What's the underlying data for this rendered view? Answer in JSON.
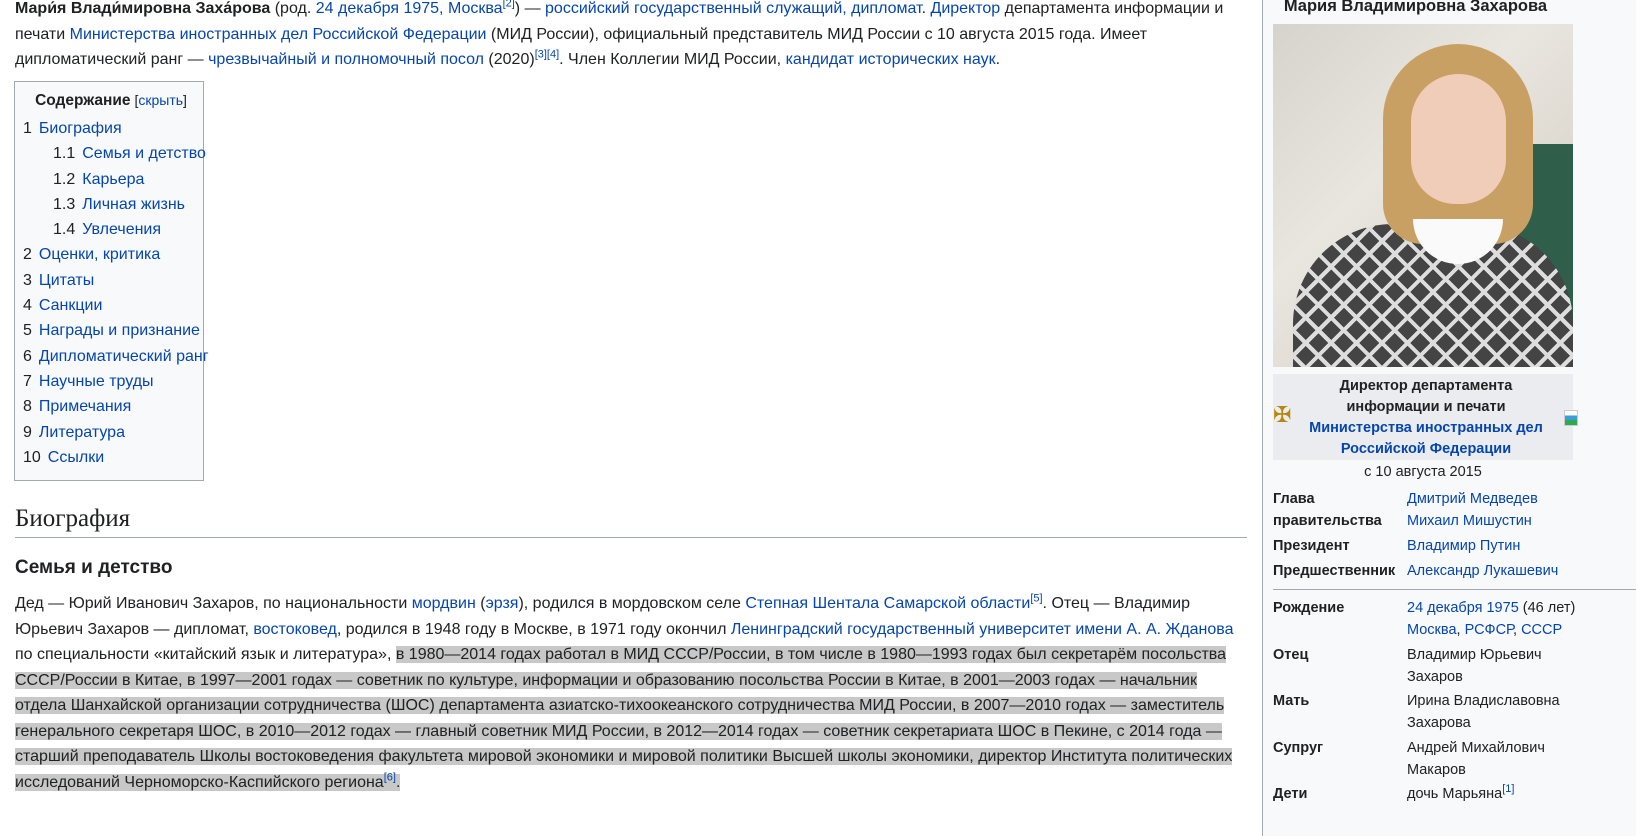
{
  "intro": {
    "name": "Мари́я Влади́мировна Заха́рова",
    "born_prefix": " (род. ",
    "born_date": "24 декабря 1975",
    "born_sep": ", ",
    "born_city": "Москва",
    "ref2": "[2]",
    "after_ref2": ") — ",
    "occupation": "российский государственный служащий, дипломат",
    "dot1": ". ",
    "director": "Директор",
    "dept_text": " департамента информации и печати ",
    "ministry": "Министерства иностранных дел Российской Федерации",
    "rep_text": " (МИД России), официальный представитель МИД России с 10 августа 2015 года. Имеет дипломатический ранг — ",
    "rank": "чрезвычайный и полномочный посол",
    "year_text": " (2020)",
    "ref3": "[3]",
    "ref4": "[4]",
    "member_text": ". Член Коллегии МИД России, ",
    "degree": "кандидат исторических наук",
    "end": "."
  },
  "toc": {
    "title": "Содержание",
    "hide_open": " [",
    "hide": "скрыть",
    "hide_close": "]",
    "items": [
      {
        "num": "1",
        "label": "Биография"
      },
      {
        "num": "1.1",
        "label": "Семья и детство"
      },
      {
        "num": "1.2",
        "label": "Карьера"
      },
      {
        "num": "1.3",
        "label": "Личная жизнь"
      },
      {
        "num": "1.4",
        "label": "Увлечения"
      },
      {
        "num": "2",
        "label": "Оценки, критика"
      },
      {
        "num": "3",
        "label": "Цитаты"
      },
      {
        "num": "4",
        "label": "Санкции"
      },
      {
        "num": "5",
        "label": "Награды и признание"
      },
      {
        "num": "6",
        "label": "Дипломатический ранг"
      },
      {
        "num": "7",
        "label": "Научные труды"
      },
      {
        "num": "8",
        "label": "Примечания"
      },
      {
        "num": "9",
        "label": "Литература"
      },
      {
        "num": "10",
        "label": "Ссылки"
      }
    ]
  },
  "headings": {
    "biography": "Биография",
    "family": "Семья и детство"
  },
  "bio": {
    "t1": "Дед — Юрий Иванович Захаров, по национальности ",
    "l_mordvin": "мордвин",
    "t2": " (",
    "l_erzya": "эрзя",
    "t3": "), родился в мордовском селе ",
    "l_village": "Степная Шентала Самарской области",
    "ref5": "[5]",
    "t4": ". Отец — Владимир Юрьевич Захаров — дипломат, ",
    "l_orientalist": "востоковед",
    "t5": ", родился в 1948 году в Москве, в 1971 году окончил ",
    "l_university": "Ленинградский государственный университет имени А. А. Жданова",
    "t6": " по специальности «китайский язык и литература», ",
    "hl_text": "в 1980—2014 годах работал в МИД СССР/России, в том числе в 1980—1993 годах был секретарём посольства СССР/России в Китае, в 1997—2001 годах — советник по культуре, информации и образованию посольства России в Китае, в 2001—2003 годах — начальник отдела Шанхайской организации сотрудничества (ШОС) департамента азиатско-тихоокеанского сотрудничества МИД России, в 2007—2010 годах — заместитель генерального секретаря ШОС, в 2010—2012 годах — главный советник МИД России, в 2012—2014 годах — советник секретариата ШОС в Пекине, с 2014 года — старший преподаватель Школы востоковедения факультета мировой экономики и мировой политики Высшей школы экономики, директор Института политических исследований Черноморско-Каспийского региона",
    "ref6": "[6]",
    "end": "."
  },
  "infobox": {
    "name": "Мария Владимировна Захарова",
    "office_line1": "Директор департамента",
    "office_line2": "информации и печати",
    "office_link": "Министерства иностранных дел Российской Федерации",
    "since": "с 10 августа 2015",
    "head_key": "Глава правительства",
    "head_values": [
      "Дмитрий Медведев",
      "Михаил Мишустин"
    ],
    "president_key": "Президент",
    "president": "Владимир Путин",
    "predecessor_key": "Предшественник",
    "predecessor": "Александр Лукашевич",
    "birth_key": "Рождение",
    "birth_date": "24 декабря 1975",
    "birth_age": " (46 лет)",
    "birth_places": [
      "Москва",
      "РСФСР",
      "СССР"
    ],
    "father_key": "Отец",
    "father": "Владимир Юрьевич Захаров",
    "mother_key": "Мать",
    "mother": "Ирина Владиславовна Захарова",
    "spouse_key": "Супруг",
    "spouse": "Андрей Михайлович Макаров",
    "children_key": "Дети",
    "children": "дочь Марьяна",
    "children_ref": "[1]"
  }
}
